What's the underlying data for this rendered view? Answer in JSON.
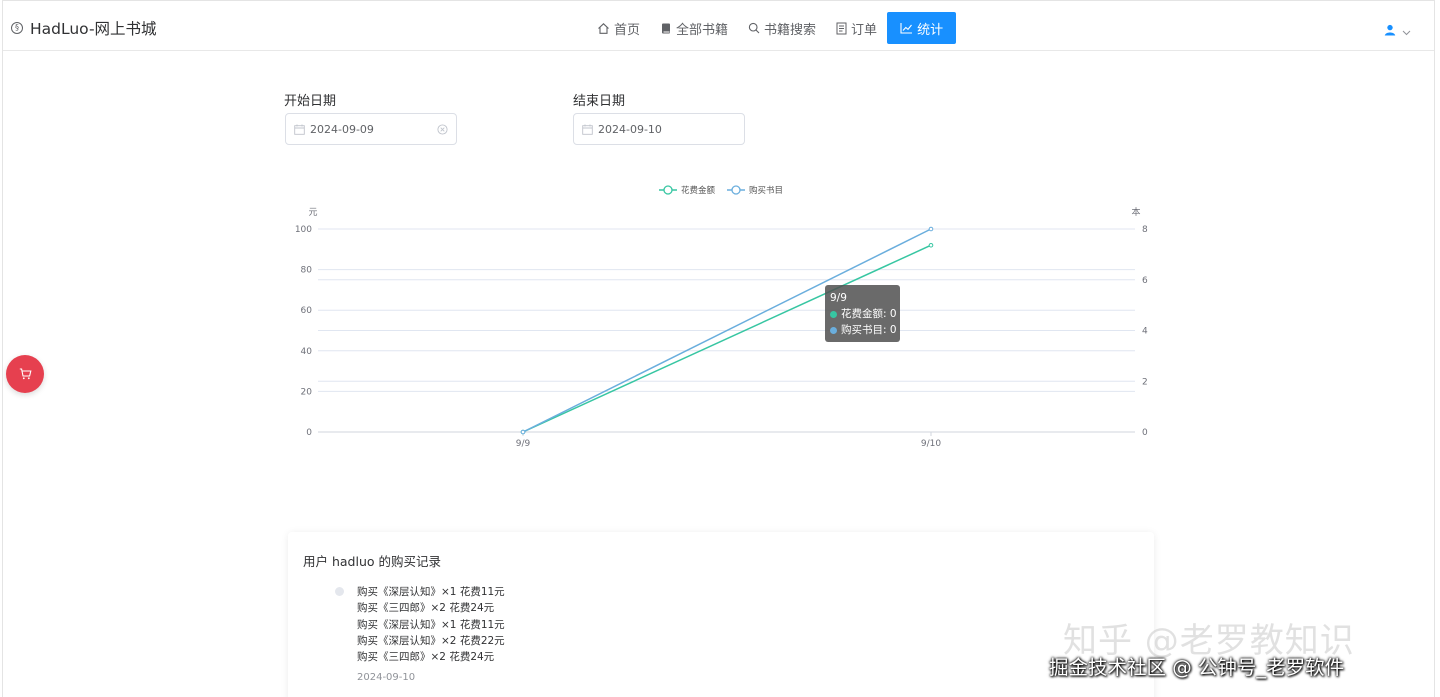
{
  "app": {
    "title": "HadLuo-网上书城"
  },
  "nav": {
    "items": [
      {
        "label": "首页",
        "icon": "home-icon"
      },
      {
        "label": "全部书籍",
        "icon": "book-icon"
      },
      {
        "label": "书籍搜索",
        "icon": "search-icon"
      },
      {
        "label": "订单",
        "icon": "document-icon"
      },
      {
        "label": "统计",
        "icon": "chart-icon",
        "active": true
      }
    ]
  },
  "user_menu": {
    "icon": "user-icon",
    "caret": "chevron-down-icon"
  },
  "filters": {
    "start": {
      "label": "开始日期",
      "value": "2024-09-09"
    },
    "end": {
      "label": "结束日期",
      "value": "2024-09-10"
    }
  },
  "colors": {
    "accent": "#1890ff",
    "spend": "#37c6a2",
    "books": "#6aaedd",
    "cart": "#e6404f"
  },
  "chart_data": {
    "type": "line",
    "categories": [
      "9/9",
      "9/10"
    ],
    "series": [
      {
        "name": "花费金额",
        "axis": "left",
        "values": [
          0,
          92
        ]
      },
      {
        "name": "购买书目",
        "axis": "right",
        "values": [
          0,
          8
        ]
      }
    ],
    "y_left": {
      "label": "元",
      "ticks": [
        0,
        20,
        40,
        60,
        80,
        100
      ],
      "ylim": [
        0,
        100
      ]
    },
    "y_right": {
      "label": "本",
      "ticks": [
        0,
        2,
        4,
        6,
        8
      ],
      "ylim": [
        0,
        8
      ]
    },
    "legend_position": "top-center",
    "grid": true
  },
  "tooltip": {
    "title": "9/9",
    "rows": [
      {
        "label": "花费金额: 0"
      },
      {
        "label": "购买书目: 0"
      }
    ]
  },
  "records": {
    "title": "用户 hadluo 的购买记录",
    "lines": [
      "购买《深层认知》×1  花费11元",
      "购买《三四郎》×2  花费24元",
      "购买《深层认知》×1  花费11元",
      "购买《深层认知》×2  花费22元",
      "购买《三四郎》×2  花费24元"
    ],
    "date": "2024-09-10"
  },
  "watermarks": {
    "zhihu": "知乎 @老罗教知识",
    "juejin": "掘金技术社区 @ 公钟号_老罗软件"
  }
}
